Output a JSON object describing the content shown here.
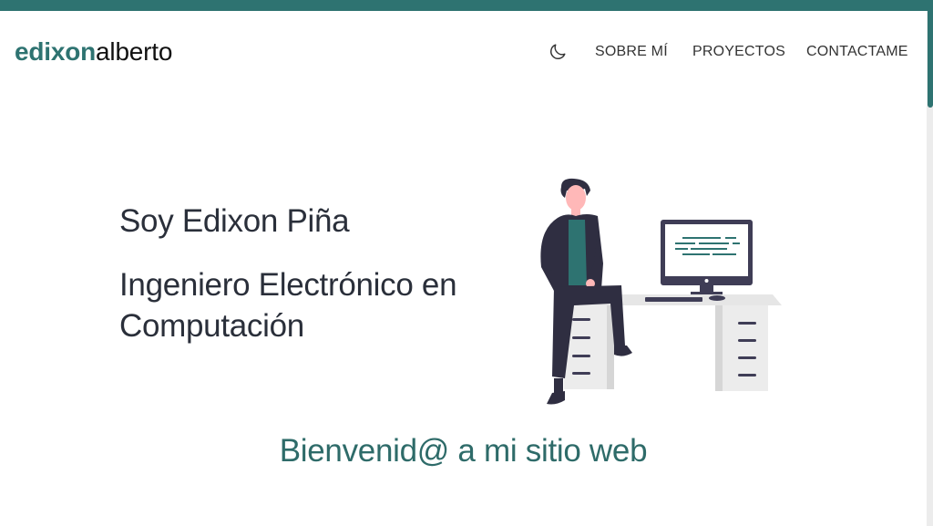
{
  "header": {
    "logo_first": "edixon",
    "logo_last": "alberto",
    "theme_toggle_icon": "moon-icon",
    "nav": {
      "about": "SOBRE MÍ",
      "projects": "PROYECTOS",
      "contact": "CONTACTAME"
    }
  },
  "hero": {
    "name_line": "Soy Edixon Piña",
    "role_line": "Ingeniero Electrónico en Computación",
    "illustration_icon": "developer-at-desk-illustration"
  },
  "welcome": {
    "text": "Bienvenid@ a mi sitio web"
  },
  "colors": {
    "accent": "#2e7371",
    "text_dark": "#2a2f3a",
    "background": "#ffffff"
  }
}
